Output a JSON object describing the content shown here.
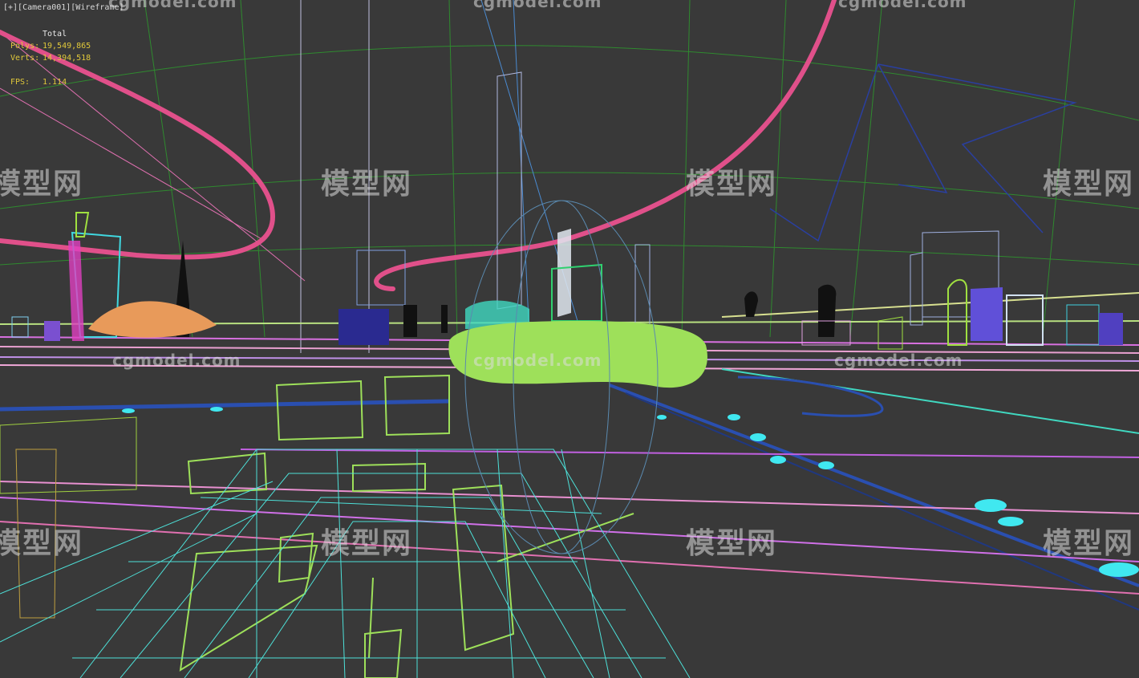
{
  "viewport": {
    "label": "[+][Camera001][Wireframe]"
  },
  "stats": {
    "header": "Total",
    "polys_label": "Polys:",
    "polys_value": "19,549,865",
    "verts_label": "Verts:",
    "verts_value": "14,394,518",
    "fps_label": "FPS:",
    "fps_value": "1.114"
  },
  "watermarks": {
    "chinese": "模型网",
    "english": "cgmodel.com"
  },
  "colors": {
    "background": "#393939",
    "stats_text": "#e0c83a",
    "pink_wire": "#e0508a",
    "green_wire": "#9ee05a",
    "cyan_wire": "#4de0d8",
    "magenta_wire": "#d070e8",
    "blue_wire": "#2a4fb0"
  }
}
